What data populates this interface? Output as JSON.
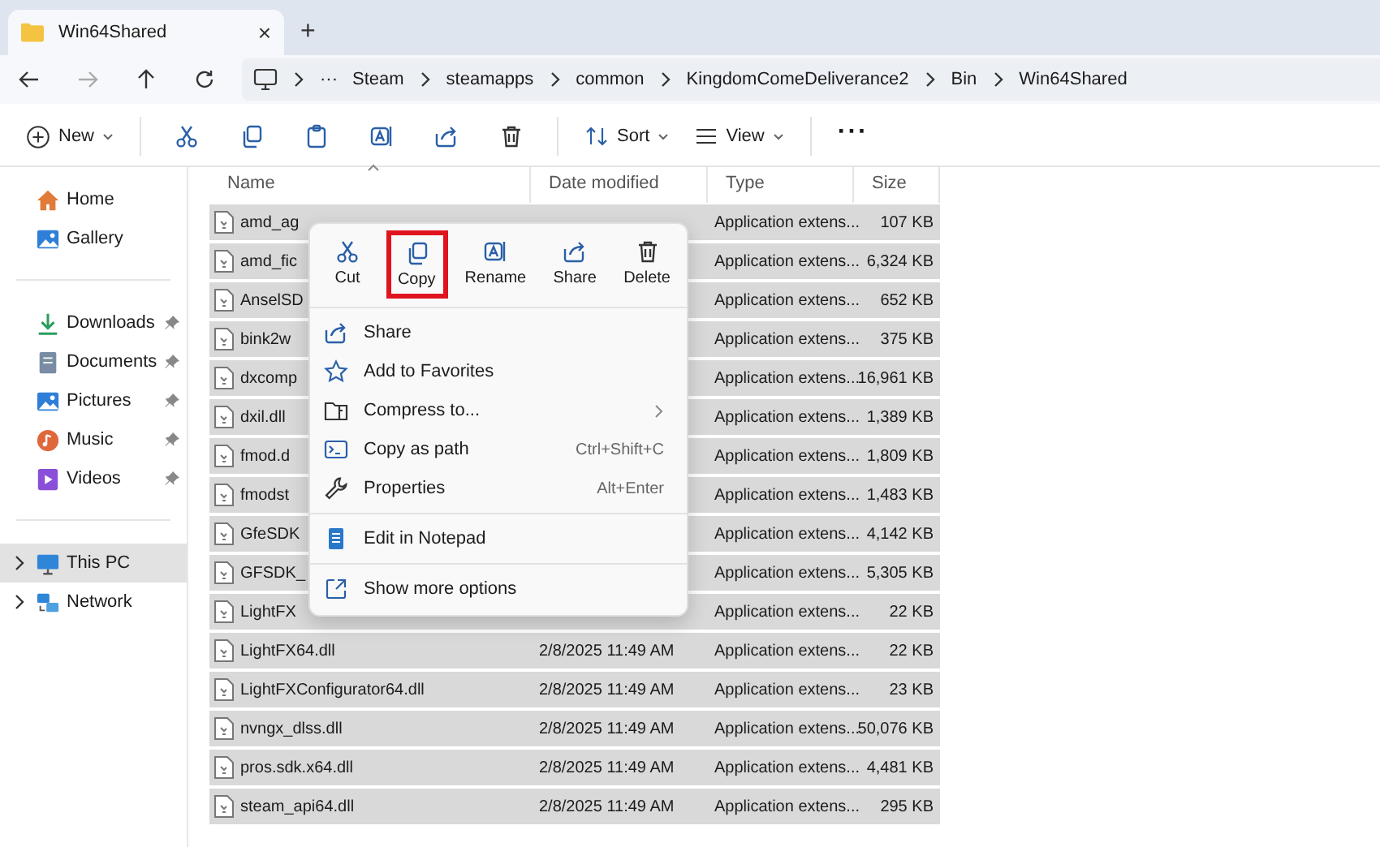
{
  "tab": {
    "title": "Win64Shared",
    "close": "×",
    "new_tab": "+"
  },
  "address": {
    "more": "···",
    "crumbs": [
      "Steam",
      "steamapps",
      "common",
      "KingdomComeDeliverance2",
      "Bin",
      "Win64Shared"
    ]
  },
  "toolbar": {
    "new": "New",
    "sort": "Sort",
    "view": "View",
    "more": "···"
  },
  "sidebar": {
    "groups": [
      [
        {
          "label": "Home",
          "pinned": false,
          "selected": false,
          "expandable": false
        },
        {
          "label": "Gallery",
          "pinned": false,
          "selected": false,
          "expandable": false
        }
      ],
      [
        {
          "label": "Downloads",
          "pinned": true,
          "selected": false,
          "expandable": false
        },
        {
          "label": "Documents",
          "pinned": true,
          "selected": false,
          "expandable": false
        },
        {
          "label": "Pictures",
          "pinned": true,
          "selected": false,
          "expandable": false
        },
        {
          "label": "Music",
          "pinned": true,
          "selected": false,
          "expandable": false
        },
        {
          "label": "Videos",
          "pinned": true,
          "selected": false,
          "expandable": false
        }
      ],
      [
        {
          "label": "This PC",
          "pinned": false,
          "selected": true,
          "expandable": true
        },
        {
          "label": "Network",
          "pinned": false,
          "selected": false,
          "expandable": true
        }
      ]
    ]
  },
  "table": {
    "columns": [
      "Name",
      "Date modified",
      "Type",
      "Size"
    ],
    "rows": [
      {
        "name": "amd_ag",
        "type": "Application extens...",
        "size": "107 KB",
        "selected": true
      },
      {
        "name": "amd_fic",
        "type": "Application extens...",
        "size": "6,324 KB",
        "selected": true
      },
      {
        "name": "AnselSD",
        "type": "Application extens...",
        "size": "652 KB",
        "selected": true
      },
      {
        "name": "bink2w",
        "type": "Application extens...",
        "size": "375 KB",
        "selected": true
      },
      {
        "name": "dxcomp",
        "type": "Application extens...",
        "size": "16,961 KB",
        "selected": true
      },
      {
        "name": "dxil.dll",
        "type": "Application extens...",
        "size": "1,389 KB",
        "selected": true
      },
      {
        "name": "fmod.d",
        "type": "Application extens...",
        "size": "1,809 KB",
        "selected": true
      },
      {
        "name": "fmodst",
        "type": "Application extens...",
        "size": "1,483 KB",
        "selected": true
      },
      {
        "name": "GfeSDK",
        "type": "Application extens...",
        "size": "4,142 KB",
        "selected": true
      },
      {
        "name": "GFSDK_",
        "type": "Application extens...",
        "size": "5,305 KB",
        "selected": true
      },
      {
        "name": "LightFX",
        "type": "Application extens...",
        "size": "22 KB",
        "selected": true
      },
      {
        "name": "LightFX64.dll",
        "date": "2/8/2025 11:49 AM",
        "type": "Application extens...",
        "size": "22 KB",
        "selected": true
      },
      {
        "name": "LightFXConfigurator64.dll",
        "date": "2/8/2025 11:49 AM",
        "type": "Application extens...",
        "size": "23 KB",
        "selected": true
      },
      {
        "name": "nvngx_dlss.dll",
        "date": "2/8/2025 11:49 AM",
        "type": "Application extens...",
        "size": "50,076 KB",
        "selected": true
      },
      {
        "name": "pros.sdk.x64.dll",
        "date": "2/8/2025 11:49 AM",
        "type": "Application extens...",
        "size": "4,481 KB",
        "selected": true
      },
      {
        "name": "steam_api64.dll",
        "date": "2/8/2025 11:49 AM",
        "type": "Application extens...",
        "size": "295 KB",
        "selected": true
      }
    ]
  },
  "context_menu": {
    "actions": [
      {
        "label": "Cut",
        "highlighted": false
      },
      {
        "label": "Copy",
        "highlighted": true
      },
      {
        "label": "Rename",
        "highlighted": false
      },
      {
        "label": "Share",
        "highlighted": false
      },
      {
        "label": "Delete",
        "highlighted": false
      }
    ],
    "sections": [
      [
        {
          "label": "Share"
        },
        {
          "label": "Add to Favorites"
        },
        {
          "label": "Compress to...",
          "submenu": true
        },
        {
          "label": "Copy as path",
          "shortcut": "Ctrl+Shift+C"
        },
        {
          "label": "Properties",
          "shortcut": "Alt+Enter"
        }
      ],
      [
        {
          "label": "Edit in Notepad"
        }
      ],
      [
        {
          "label": "Show more options"
        }
      ]
    ]
  }
}
